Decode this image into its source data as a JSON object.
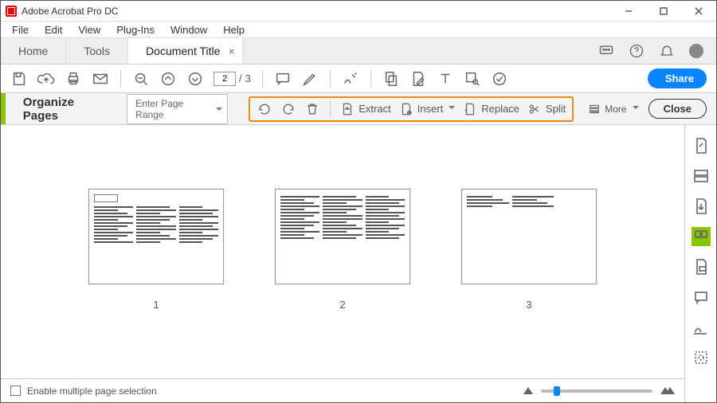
{
  "window": {
    "title": "Adobe Acrobat Pro DC"
  },
  "menu": [
    "File",
    "Edit",
    "View",
    "Plug-Ins",
    "Window",
    "Help"
  ],
  "tabs": {
    "home": "Home",
    "tools": "Tools",
    "doc": "Document Title"
  },
  "toolbar": {
    "page_current": "2",
    "page_total": "3",
    "share": "Share"
  },
  "org": {
    "title": "Organize Pages",
    "range": "Enter Page Range",
    "extract": "Extract",
    "insert": "Insert",
    "replace": "Replace",
    "split": "Split",
    "more": "More",
    "close": "Close"
  },
  "pages": [
    "1",
    "2",
    "3"
  ],
  "status": {
    "multisel": "Enable multiple page selection"
  }
}
